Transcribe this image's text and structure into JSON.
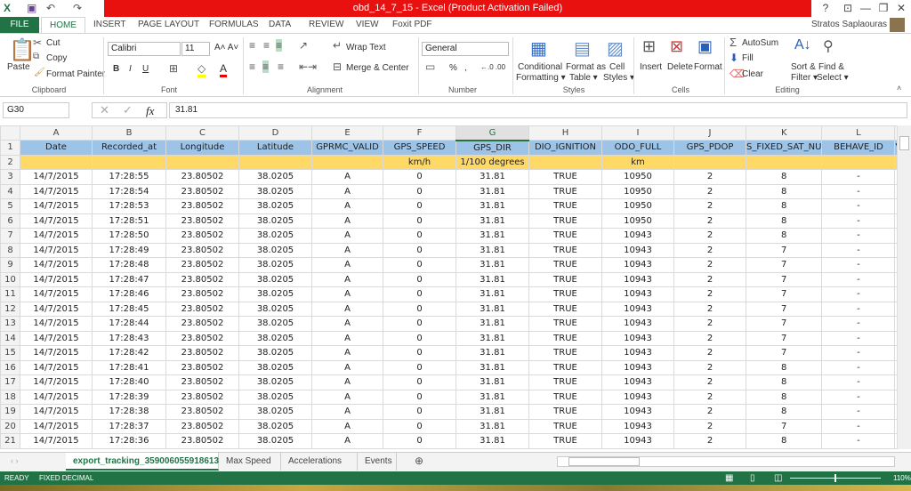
{
  "window": {
    "title": "obd_14_7_15 -  Excel (Product Activation Failed)",
    "user": "Stratos Saplaouras",
    "controls": [
      "?",
      "⊡",
      "—",
      "❐",
      "✕"
    ]
  },
  "ribbon_tabs": [
    "FILE",
    "HOME",
    "INSERT",
    "PAGE LAYOUT",
    "FORMULAS",
    "DATA",
    "REVIEW",
    "VIEW",
    "Foxit PDF"
  ],
  "clipboard": {
    "paste": "Paste",
    "cut": "Cut",
    "copy": "Copy",
    "format_painter": "Format Painter",
    "group": "Clipboard"
  },
  "font": {
    "name": "Calibri",
    "size": "11",
    "bold": "B",
    "italic": "I",
    "underline": "U",
    "group": "Font"
  },
  "alignment": {
    "wrap": "Wrap Text",
    "merge": "Merge & Center",
    "group": "Alignment"
  },
  "number": {
    "format": "General",
    "percent": "%",
    "comma": ",",
    "group": "Number"
  },
  "styles": {
    "conditional": [
      "Conditional",
      "Formatting ▾"
    ],
    "format_table": [
      "Format as",
      "Table ▾"
    ],
    "cell_styles": [
      "Cell",
      "Styles ▾"
    ],
    "group": "Styles"
  },
  "cells": {
    "insert": "Insert",
    "delete": "Delete",
    "format": "Format",
    "group": "Cells"
  },
  "editing": {
    "autosum": "AutoSum",
    "fill": "Fill",
    "clear": "Clear",
    "sort": [
      "Sort &",
      "Filter ▾"
    ],
    "find": [
      "Find &",
      "Select ▾"
    ],
    "group": "Editing"
  },
  "formula_bar": {
    "name_box": "G30",
    "value": "31.81",
    "fx": "fx"
  },
  "columns": [
    "A",
    "B",
    "C",
    "D",
    "E",
    "F",
    "G",
    "H",
    "I",
    "J",
    "K",
    "L"
  ],
  "selected_column": "G",
  "header_row": [
    "Date",
    "Recorded_at",
    "Longitude",
    "Latitude",
    "GPRMC_VALID",
    "GPS_SPEED",
    "GPS_DIR",
    "DIO_IGNITION",
    "ODO_FULL",
    "GPS_PDOP",
    "S_FIXED_SAT_NU",
    "BEHAVE_ID"
  ],
  "header_overflow": "V",
  "units_row": [
    "",
    "",
    "",
    "",
    "",
    "km/h",
    "1/100 degrees",
    "",
    "km",
    "",
    "",
    ""
  ],
  "rows": [
    [
      "14/7/2015",
      "17:28:55",
      "23.80502",
      "38.0205",
      "A",
      "0",
      "31.81",
      "TRUE",
      "10950",
      "2",
      "8",
      "-"
    ],
    [
      "14/7/2015",
      "17:28:54",
      "23.80502",
      "38.0205",
      "A",
      "0",
      "31.81",
      "TRUE",
      "10950",
      "2",
      "8",
      "-"
    ],
    [
      "14/7/2015",
      "17:28:53",
      "23.80502",
      "38.0205",
      "A",
      "0",
      "31.81",
      "TRUE",
      "10950",
      "2",
      "8",
      "-"
    ],
    [
      "14/7/2015",
      "17:28:51",
      "23.80502",
      "38.0205",
      "A",
      "0",
      "31.81",
      "TRUE",
      "10950",
      "2",
      "8",
      "-"
    ],
    [
      "14/7/2015",
      "17:28:50",
      "23.80502",
      "38.0205",
      "A",
      "0",
      "31.81",
      "TRUE",
      "10943",
      "2",
      "8",
      "-"
    ],
    [
      "14/7/2015",
      "17:28:49",
      "23.80502",
      "38.0205",
      "A",
      "0",
      "31.81",
      "TRUE",
      "10943",
      "2",
      "7",
      "-"
    ],
    [
      "14/7/2015",
      "17:28:48",
      "23.80502",
      "38.0205",
      "A",
      "0",
      "31.81",
      "TRUE",
      "10943",
      "2",
      "7",
      "-"
    ],
    [
      "14/7/2015",
      "17:28:47",
      "23.80502",
      "38.0205",
      "A",
      "0",
      "31.81",
      "TRUE",
      "10943",
      "2",
      "7",
      "-"
    ],
    [
      "14/7/2015",
      "17:28:46",
      "23.80502",
      "38.0205",
      "A",
      "0",
      "31.81",
      "TRUE",
      "10943",
      "2",
      "7",
      "-"
    ],
    [
      "14/7/2015",
      "17:28:45",
      "23.80502",
      "38.0205",
      "A",
      "0",
      "31.81",
      "TRUE",
      "10943",
      "2",
      "7",
      "-"
    ],
    [
      "14/7/2015",
      "17:28:44",
      "23.80502",
      "38.0205",
      "A",
      "0",
      "31.81",
      "TRUE",
      "10943",
      "2",
      "7",
      "-"
    ],
    [
      "14/7/2015",
      "17:28:43",
      "23.80502",
      "38.0205",
      "A",
      "0",
      "31.81",
      "TRUE",
      "10943",
      "2",
      "7",
      "-"
    ],
    [
      "14/7/2015",
      "17:28:42",
      "23.80502",
      "38.0205",
      "A",
      "0",
      "31.81",
      "TRUE",
      "10943",
      "2",
      "7",
      "-"
    ],
    [
      "14/7/2015",
      "17:28:41",
      "23.80502",
      "38.0205",
      "A",
      "0",
      "31.81",
      "TRUE",
      "10943",
      "2",
      "8",
      "-"
    ],
    [
      "14/7/2015",
      "17:28:40",
      "23.80502",
      "38.0205",
      "A",
      "0",
      "31.81",
      "TRUE",
      "10943",
      "2",
      "8",
      "-"
    ],
    [
      "14/7/2015",
      "17:28:39",
      "23.80502",
      "38.0205",
      "A",
      "0",
      "31.81",
      "TRUE",
      "10943",
      "2",
      "8",
      "-"
    ],
    [
      "14/7/2015",
      "17:28:38",
      "23.80502",
      "38.0205",
      "A",
      "0",
      "31.81",
      "TRUE",
      "10943",
      "2",
      "8",
      "-"
    ],
    [
      "14/7/2015",
      "17:28:37",
      "23.80502",
      "38.0205",
      "A",
      "0",
      "31.81",
      "TRUE",
      "10943",
      "2",
      "7",
      "-"
    ],
    [
      "14/7/2015",
      "17:28:36",
      "23.80502",
      "38.0205",
      "A",
      "0",
      "31.81",
      "TRUE",
      "10943",
      "2",
      "8",
      "-"
    ]
  ],
  "sheets": [
    "export_tracking_359006055918613",
    "Max Speed",
    "Accelerations",
    "Events"
  ],
  "active_sheet": 0,
  "status": {
    "mode": "READY",
    "flag": "FIXED DECIMAL",
    "zoom": "110%"
  },
  "colors": {
    "accent": "#217346",
    "title_band": "#e8110f",
    "header_fill": "#9dc3e6",
    "units_fill": "#ffd966"
  }
}
